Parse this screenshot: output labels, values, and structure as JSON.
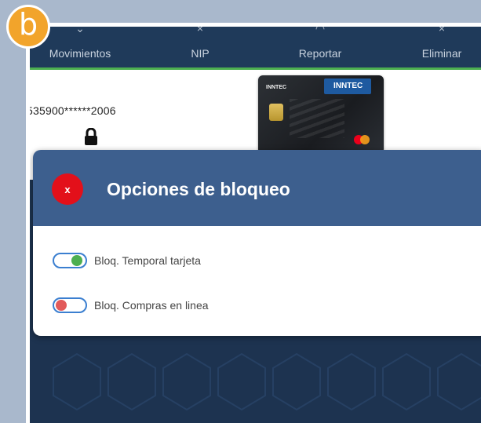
{
  "badge": {
    "letter": "b",
    "color": "#f2a42b"
  },
  "nav": {
    "items": [
      {
        "label": "Movimientos",
        "icon": "arrow-icon"
      },
      {
        "label": "NIP",
        "icon": "close-icon"
      },
      {
        "label": "Reportar",
        "icon": "circle-icon"
      },
      {
        "label": "Eliminar",
        "icon": "close-icon"
      }
    ]
  },
  "card": {
    "number": "535900******2006",
    "brand": "INNTEC",
    "lock_icon": "lock-icon"
  },
  "dialog": {
    "title": "Opciones de bloqueo",
    "close_label": "x",
    "options": [
      {
        "label": "Bloq. Temporal tarjeta",
        "state": "on",
        "knob_color": "#4caf50"
      },
      {
        "label": "Bloq. Compras en linea",
        "state": "off",
        "knob_color": "#e25a5a"
      }
    ]
  },
  "colors": {
    "header": "#3d5f8e",
    "toggle_border": "#3b7fd0",
    "close_button": "#e3101a",
    "nav_accent": "#4caf50"
  }
}
